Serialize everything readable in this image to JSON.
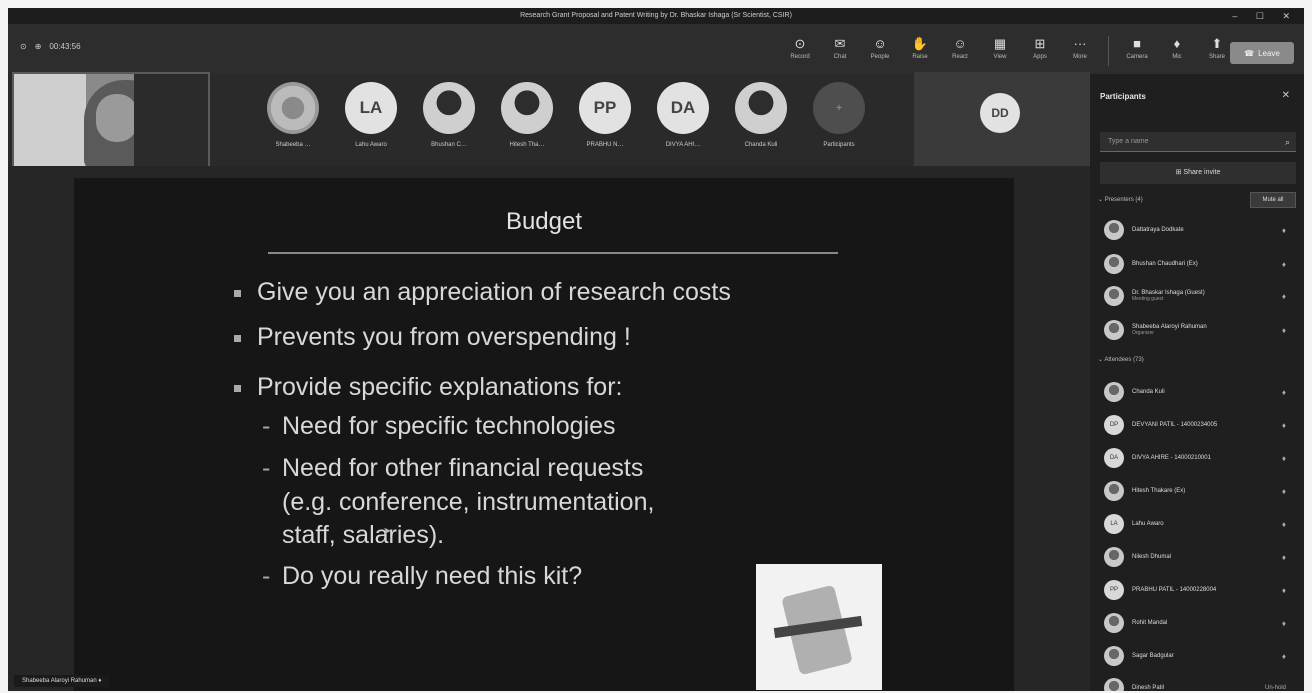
{
  "window": {
    "title": "Research Grant Proposal and Patent Writing by Dr. Bhaskar Ishaga (Sr Scientist, CSIR)",
    "controls": "– ☐ ✕"
  },
  "toolbar": {
    "timer": "00:43:56",
    "buttons": [
      {
        "label": "Record",
        "icon": "⊙"
      },
      {
        "label": "Chat",
        "icon": "✉"
      },
      {
        "label": "People",
        "icon": "☺"
      },
      {
        "label": "Raise",
        "icon": "✋"
      },
      {
        "label": "React",
        "icon": "☺"
      },
      {
        "label": "View",
        "icon": "▦"
      },
      {
        "label": "Apps",
        "icon": "⊞"
      },
      {
        "label": "More",
        "icon": "···"
      },
      {
        "label": "Camera",
        "icon": "■"
      },
      {
        "label": "Mic",
        "icon": "♦"
      },
      {
        "label": "Share",
        "icon": "⬆"
      }
    ],
    "leave_label": "Leave"
  },
  "stage": {
    "participants": [
      {
        "initials": "",
        "name": "Shabeeba …",
        "kind": "logo"
      },
      {
        "initials": "LA",
        "name": "Lahu Awaro",
        "kind": "initials"
      },
      {
        "initials": "",
        "name": "Bhushan C…",
        "kind": "photo"
      },
      {
        "initials": "",
        "name": "Hitesh Tha…",
        "kind": "photo"
      },
      {
        "initials": "PP",
        "name": "PRABHU N…",
        "kind": "initials"
      },
      {
        "initials": "DA",
        "name": "DIVYA AHI…",
        "kind": "initials"
      },
      {
        "initials": "",
        "name": "Chanda Kuli",
        "kind": "photo"
      },
      {
        "initials": "+",
        "name": "Participants",
        "kind": "more"
      }
    ],
    "dd_initials": "DD",
    "presenter_name": "Shabeeba Alaroyi Rahuman"
  },
  "slide": {
    "title": "Budget",
    "bullets": [
      "Give you an appreciation of research costs",
      "Prevents you from overspending !",
      "Provide specific explanations for:"
    ],
    "subbullets": [
      "Need for specific technologies",
      "Need for other financial requests",
      "(e.g. conference, instrumentation,",
      "staff, salaries).",
      "Do you really need this kit?"
    ]
  },
  "panel": {
    "title": "Participants",
    "search_placeholder": "Type a name",
    "share_invite": "Share invite",
    "presenters_header": "Presenters (4)",
    "mute_all": "Mute all",
    "presenters": [
      {
        "name": "Dattatraya Dodkate",
        "role": ""
      },
      {
        "name": "Bhushan Chaudhari (Ex)",
        "role": ""
      },
      {
        "name": "Dr. Bhaskar Ishaga (Guest)",
        "role": "Meeting guest"
      },
      {
        "name": "Shabeeba Alaroyi Rahuman",
        "role": "Organizer"
      }
    ],
    "attendees_header": "Attendees (73)",
    "attendees": [
      {
        "name": "Chanda Kuli",
        "initials": ""
      },
      {
        "name": "DEVYANI PATIL - 14000234005",
        "initials": "DP"
      },
      {
        "name": "DIVYA AHIRE - 14000210001",
        "initials": "DA"
      },
      {
        "name": "Hitesh Thakare (Ex)",
        "initials": ""
      },
      {
        "name": "Lahu Awaro",
        "initials": "LA"
      },
      {
        "name": "Nilesh Dhumal",
        "initials": ""
      },
      {
        "name": "PRABHU PATIL - 14000228004",
        "initials": "PP"
      },
      {
        "name": "Rohit Mandal",
        "initials": ""
      },
      {
        "name": "Sagar Badgular",
        "initials": ""
      },
      {
        "name": "Dinesh Patil",
        "initials": ""
      }
    ],
    "last_badge": "Un-hold"
  }
}
